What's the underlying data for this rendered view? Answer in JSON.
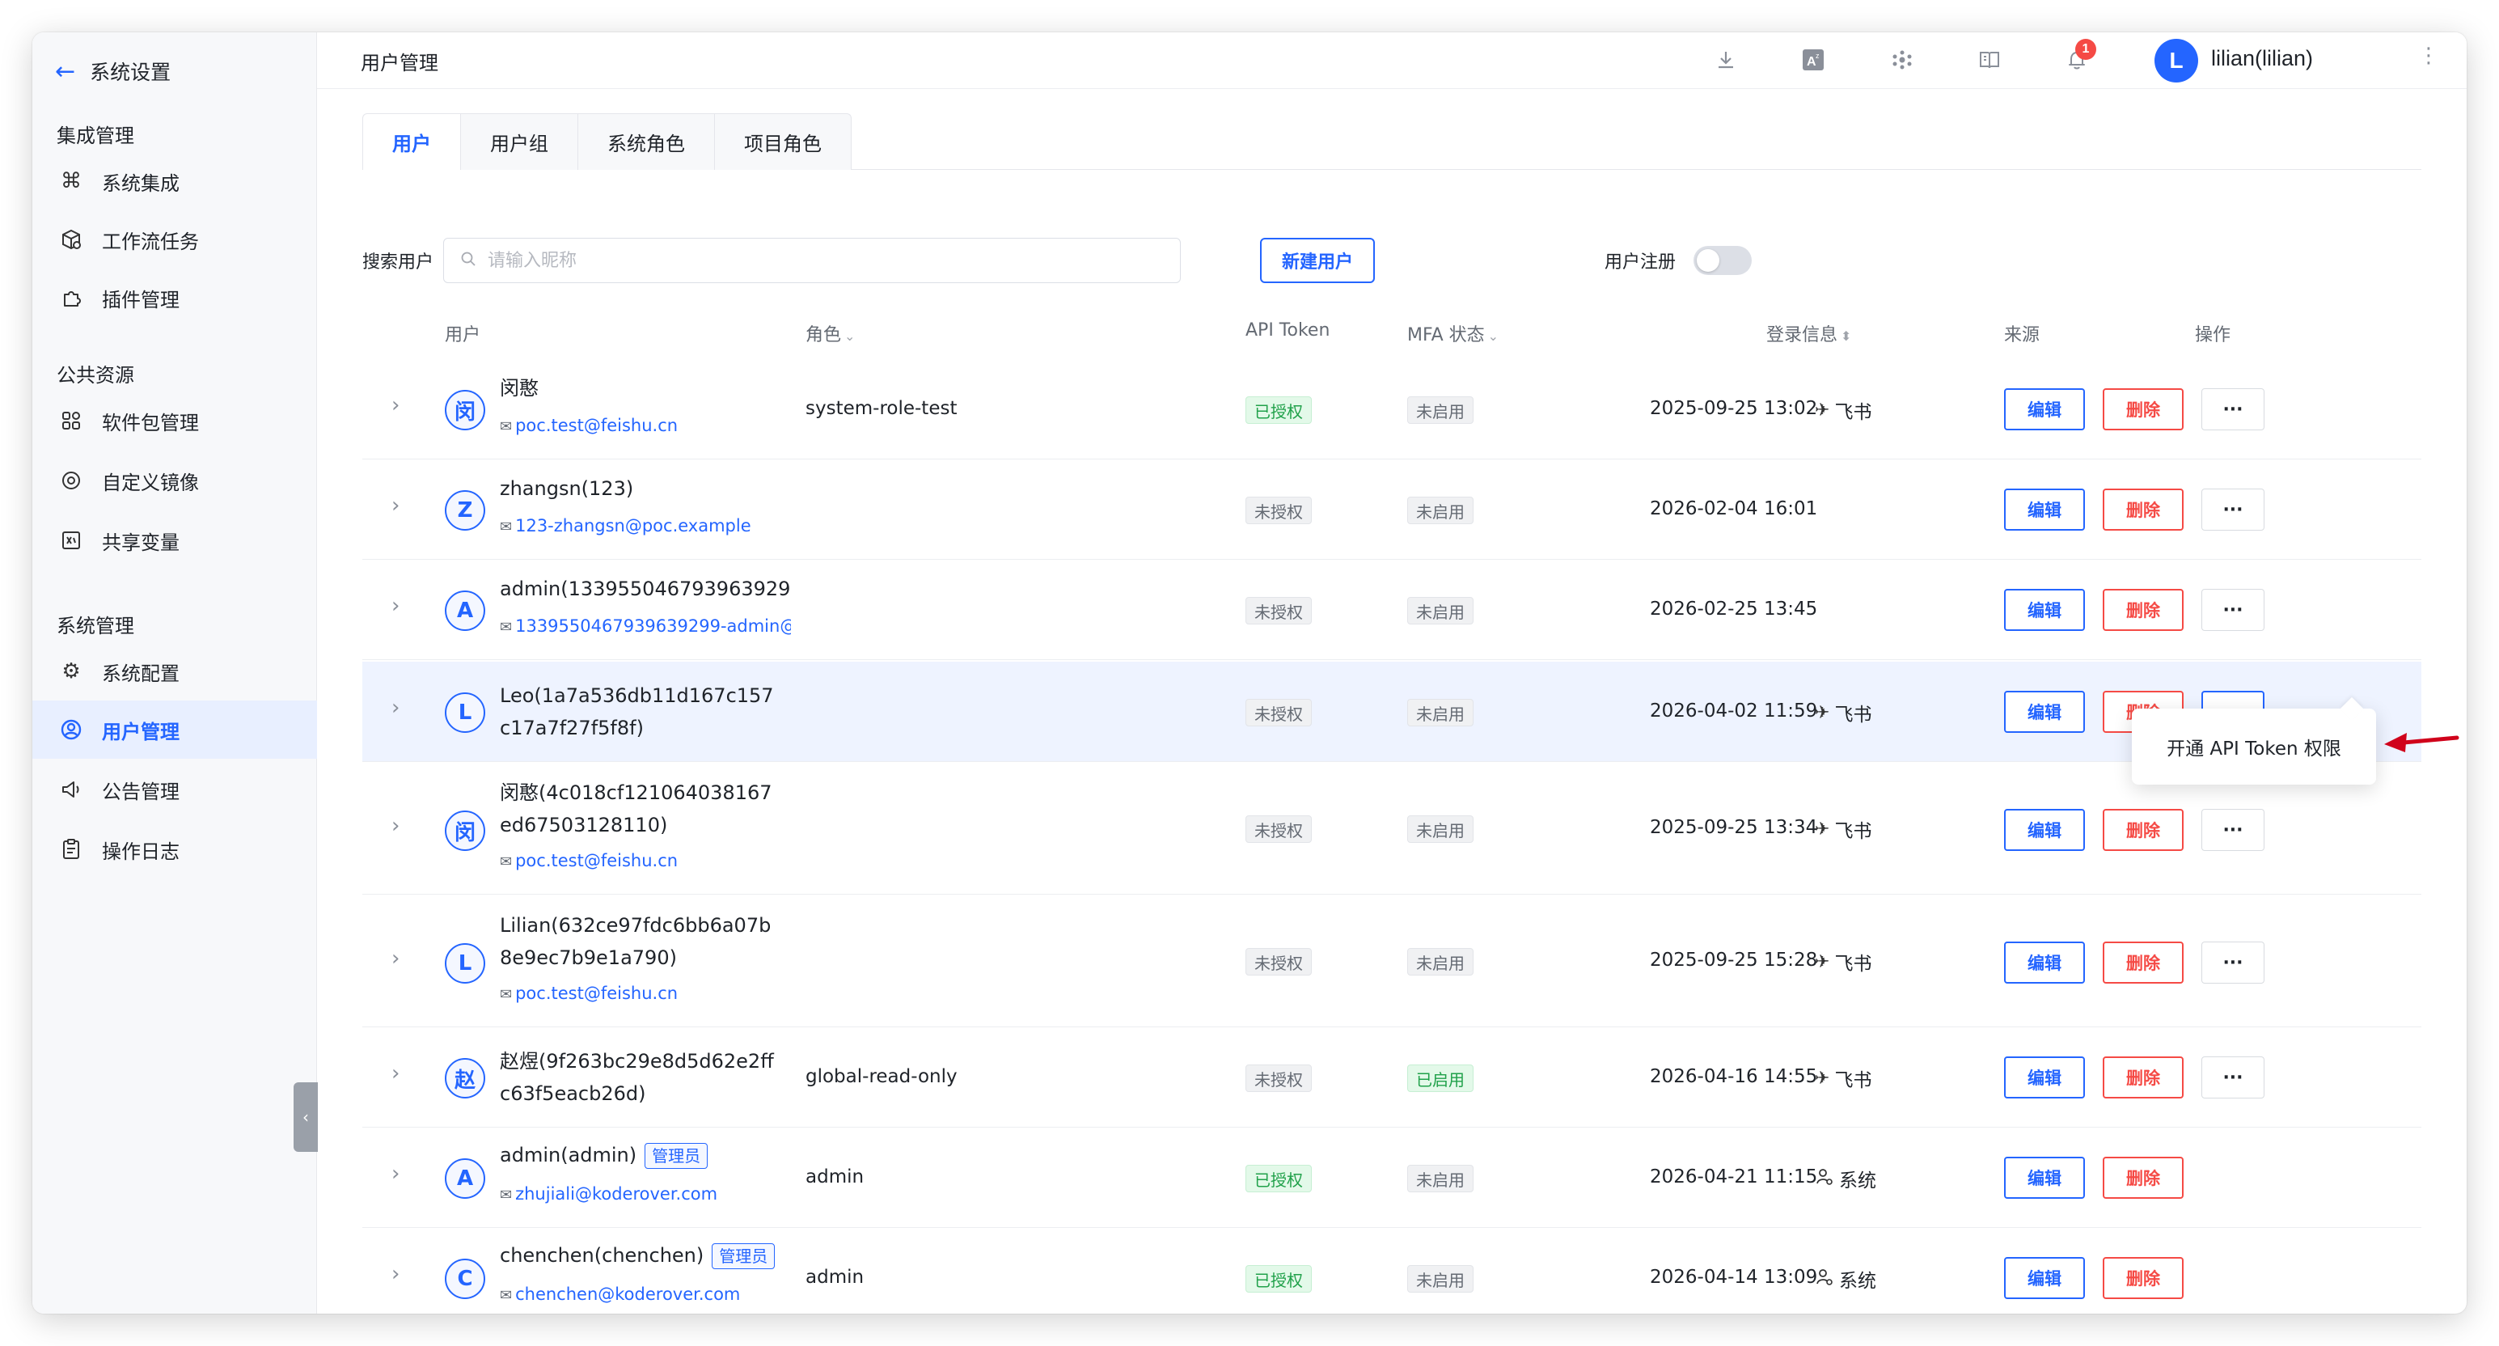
{
  "sidebar": {
    "back_label": "系统设置",
    "groups": [
      {
        "title": "集成管理",
        "items": [
          {
            "label": "系统集成",
            "icon": "command-icon"
          },
          {
            "label": "工作流任务",
            "icon": "workflow-cube-icon"
          },
          {
            "label": "插件管理",
            "icon": "puzzle-icon"
          }
        ]
      },
      {
        "title": "公共资源",
        "items": [
          {
            "label": "软件包管理",
            "icon": "grid-icon"
          },
          {
            "label": "自定义镜像",
            "icon": "disc-icon"
          },
          {
            "label": "共享变量",
            "icon": "variable-icon"
          }
        ]
      },
      {
        "title": "系统管理",
        "items": [
          {
            "label": "系统配置",
            "icon": "gear-icon"
          },
          {
            "label": "用户管理",
            "icon": "user-circle-icon"
          },
          {
            "label": "公告管理",
            "icon": "megaphone-icon"
          },
          {
            "label": "操作日志",
            "icon": "clipboard-icon"
          }
        ]
      }
    ]
  },
  "header": {
    "title": "用户管理",
    "notification_count": "1",
    "user_initial": "L",
    "user_name": "lilian(lilian)"
  },
  "tabs": [
    {
      "label": "用户"
    },
    {
      "label": "用户组"
    },
    {
      "label": "系统角色"
    },
    {
      "label": "项目角色"
    }
  ],
  "toolbar": {
    "search_label": "搜索用户",
    "search_placeholder": "请输入昵称",
    "new_user_label": "新建用户",
    "register_label": "用户注册"
  },
  "table": {
    "columns": {
      "user": "用户",
      "role": "角色",
      "api_token": "API Token",
      "mfa": "MFA 状态",
      "login": "登录信息",
      "source": "来源",
      "actions": "操作"
    },
    "edit_label": "编辑",
    "delete_label": "删除",
    "more_label": "···",
    "rows": [
      {
        "initial": "闵",
        "name": "闵憨",
        "email": "poc.test@feishu.cn",
        "role": "system-role-test",
        "token": "已授权",
        "mfa": "未启用",
        "login": "2025-09-25 13:02",
        "source": "飞书"
      },
      {
        "initial": "Z",
        "name": "zhangsn(123)",
        "email": "123-zhangsn@poc.example",
        "role": "",
        "token": "未授权",
        "mfa": "未启用",
        "login": "2026-02-04 16:01",
        "source": ""
      },
      {
        "initial": "A",
        "name": "admin(133955046793963929§",
        "email": "1339550467939639299-admin@",
        "role": "",
        "token": "未授权",
        "mfa": "未启用",
        "login": "2026-02-25 13:45",
        "source": ""
      },
      {
        "initial": "L",
        "name": "Leo(1a7a536db11d167c157c17a7f27f5f8f)",
        "email": "",
        "role": "",
        "token": "未授权",
        "mfa": "未启用",
        "login": "2026-04-02 11:59",
        "source": "飞书"
      },
      {
        "initial": "闵",
        "name": "闵憨(4c018cf121064038167ed67503128110)",
        "email": "poc.test@feishu.cn",
        "role": "",
        "token": "未授权",
        "mfa": "未启用",
        "login": "2025-09-25 13:34",
        "source": "飞书"
      },
      {
        "initial": "L",
        "name": "Lilian(632ce97fdc6bb6a07b8e9ec7b9e1a790)",
        "email": "poc.test@feishu.cn",
        "role": "",
        "token": "未授权",
        "mfa": "未启用",
        "login": "2025-09-25 15:28",
        "source": "飞书"
      },
      {
        "initial": "赵",
        "name": "赵煜(9f263bc29e8d5d62e2ffc63f5eacb26d)",
        "email": "",
        "role": "global-read-only",
        "token": "未授权",
        "mfa": "已启用",
        "login": "2026-04-16 14:55",
        "source": "飞书"
      },
      {
        "initial": "A",
        "name": "admin(admin)",
        "tag": "管理员",
        "email": "zhujiali@koderover.com",
        "role": "admin",
        "token": "已授权",
        "mfa": "未启用",
        "login": "2026-04-21 11:15",
        "source": "系统"
      },
      {
        "initial": "C",
        "name": "chenchen(chenchen)",
        "tag": "管理员",
        "email": "chenchen@koderover.com",
        "role": "admin",
        "token": "已授权",
        "mfa": "未启用",
        "login": "2026-04-14 13:09",
        "source": "系统"
      }
    ]
  },
  "popover": {
    "item_label": "开通 API Token 权限"
  },
  "colors": {
    "primary": "#2465ff",
    "danger": "#f54a45",
    "success": "#20a14a",
    "annotation": "#d0021b"
  }
}
